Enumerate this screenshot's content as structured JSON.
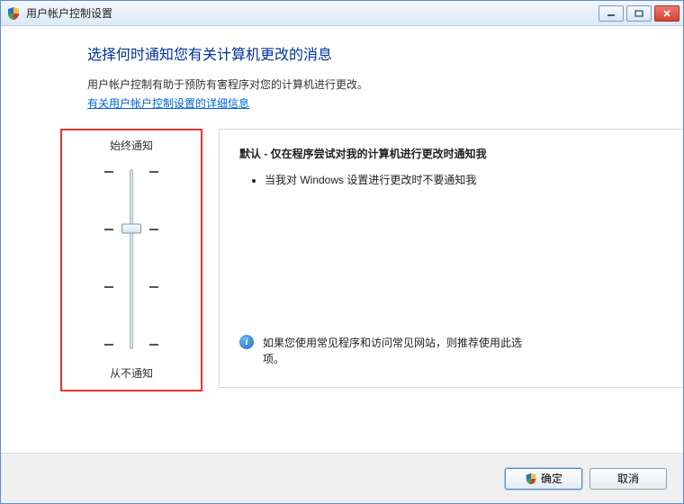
{
  "window": {
    "title": "用户帐户控制设置"
  },
  "header": {
    "page_title": "选择何时通知您有关计算机更改的消息",
    "description": "用户帐户控制有助于预防有害程序对您的计算机进行更改。",
    "info_link": "有关用户帐户控制设置的详细信息"
  },
  "slider": {
    "top_label": "始终通知",
    "bottom_label": "从不通知",
    "levels_total": 4,
    "selected_index": 1
  },
  "level": {
    "title": "默认 - 仅在程序尝试对我的计算机进行更改时通知我",
    "bullets": [
      "当我对 Windows 设置进行更改时不要通知我"
    ],
    "recommendation": "如果您使用常见程序和访问常见网站，则推荐使用此选项。"
  },
  "footer": {
    "ok_label": "确定",
    "cancel_label": "取消"
  }
}
